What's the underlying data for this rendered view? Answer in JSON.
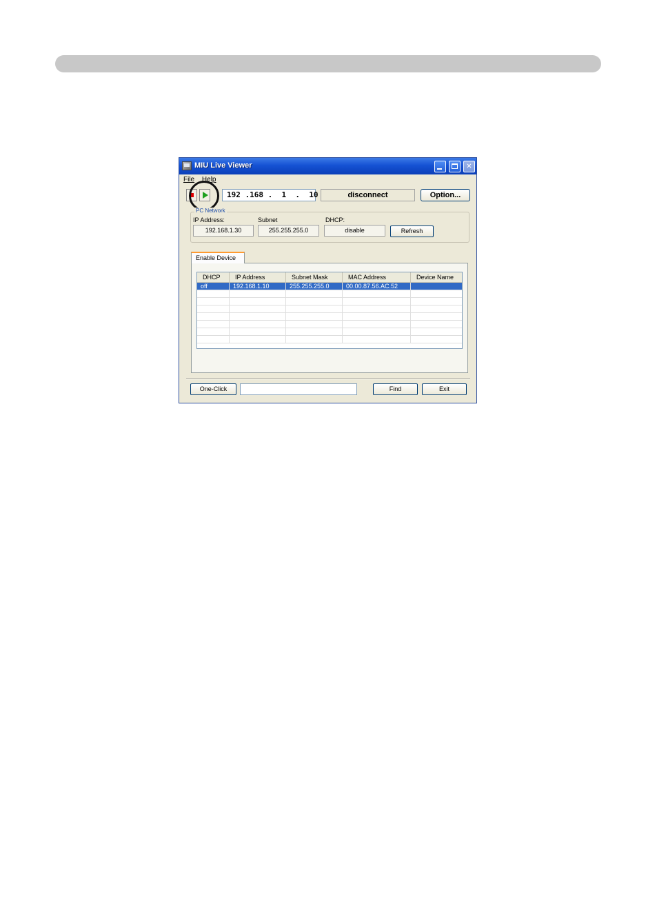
{
  "window": {
    "title": "MIU Live Viewer"
  },
  "menu": {
    "items": [
      "File",
      "Help"
    ]
  },
  "toolbar": {
    "ip_address": "192 .168 .  1  .  10",
    "connection_status": "disconnect",
    "option_label": "Option..."
  },
  "pc_network": {
    "legend": "PC Network",
    "ip_label": "IP Address:",
    "ip_value": "192.168.1.30",
    "subnet_label": "Subnet",
    "subnet_value": "255.255.255.0",
    "dhcp_label": "DHCP:",
    "dhcp_value": "disable",
    "refresh_label": "Refresh"
  },
  "tab": {
    "label": "Enable Device"
  },
  "device_table": {
    "columns": [
      "DHCP",
      "IP Address",
      "Subnet Mask",
      "MAC Address",
      "Device Name"
    ],
    "rows": [
      [
        "off",
        "192.168.1.10",
        "255.255.255.0",
        "00.00.87.56.AC.52",
        ""
      ]
    ]
  },
  "bottom": {
    "one_click_label": "One-Click",
    "status_value": "",
    "find_label": "Find",
    "exit_label": "Exit"
  },
  "colors": {
    "titlebar": "#1552d4",
    "selected_row": "#316ac5",
    "highlight_circle": "#111111"
  }
}
